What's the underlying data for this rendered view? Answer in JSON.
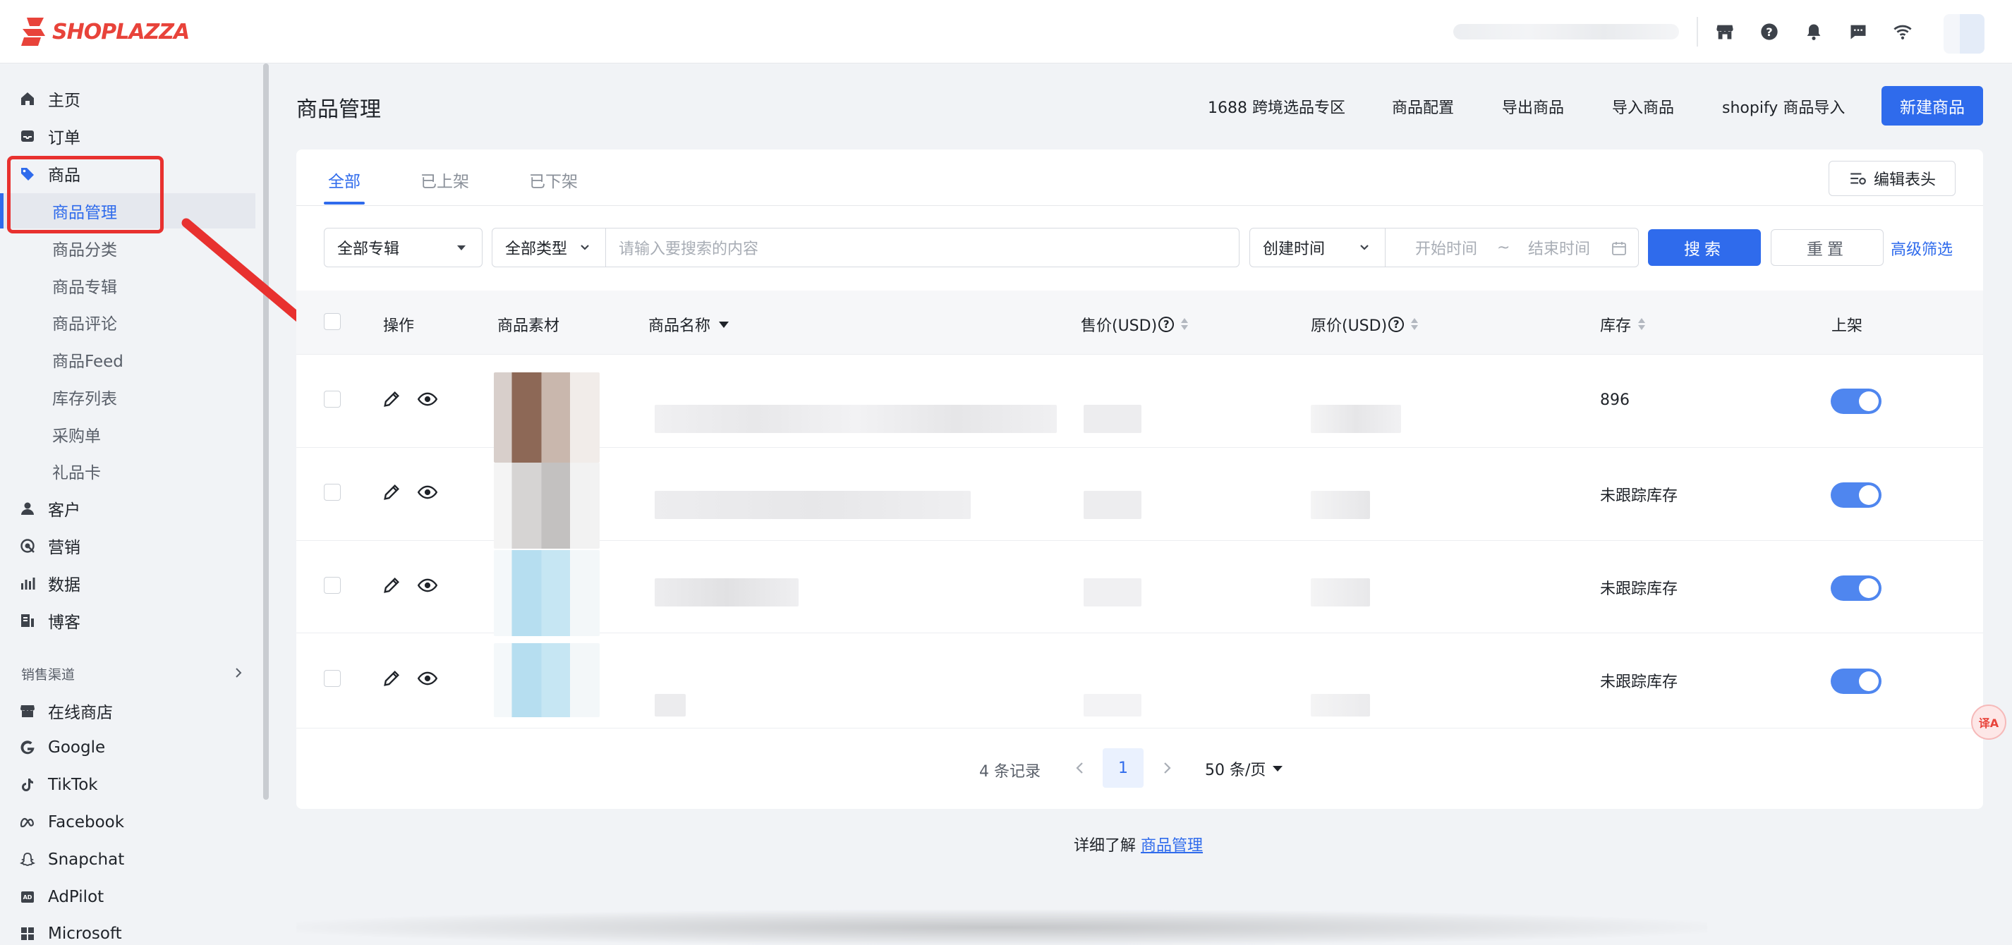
{
  "brand": {
    "name": "SHOPLAZZA",
    "color": "#e8433a"
  },
  "accent": "#2f6bec",
  "topbar": {
    "icons": [
      "store-icon",
      "help-icon",
      "bell-icon",
      "message-icon",
      "wifi-icon"
    ]
  },
  "sidebar": {
    "items": [
      {
        "label": "主页",
        "icon": "home-icon"
      },
      {
        "label": "订单",
        "icon": "inbox-icon"
      },
      {
        "label": "商品",
        "icon": "tag-icon"
      },
      {
        "label": "客户",
        "icon": "user-icon"
      },
      {
        "label": "营销",
        "icon": "target-icon"
      },
      {
        "label": "数据",
        "icon": "bar-chart-icon"
      },
      {
        "label": "博客",
        "icon": "blog-icon"
      }
    ],
    "sub_items": [
      "商品管理",
      "商品分类",
      "商品专辑",
      "商品评论",
      "商品Feed",
      "库存列表",
      "采购单",
      "礼品卡"
    ],
    "active_sub": "商品管理",
    "section_title": "销售渠道",
    "channels": [
      {
        "label": "在线商店",
        "icon": "store-icon"
      },
      {
        "label": "Google",
        "icon": "google-icon"
      },
      {
        "label": "TikTok",
        "icon": "tiktok-icon"
      },
      {
        "label": "Facebook",
        "icon": "meta-icon"
      },
      {
        "label": "Snapchat",
        "icon": "snapchat-icon"
      },
      {
        "label": "AdPilot",
        "icon": "adpilot-icon"
      },
      {
        "label": "Microsoft",
        "icon": "microsoft-icon"
      }
    ]
  },
  "page": {
    "title": "商品管理",
    "actions": [
      "1688 跨境选品专区",
      "商品配置",
      "导出商品",
      "导入商品",
      "shopify 商品导入"
    ],
    "primary_action": "新建商品"
  },
  "tabs": [
    "全部",
    "已上架",
    "已下架"
  ],
  "active_tab": "全部",
  "edit_header_label": "编辑表头",
  "filters": {
    "collection": "全部专辑",
    "type": "全部类型",
    "search_placeholder": "请输入要搜索的内容",
    "date_field": "创建时间",
    "start_placeholder": "开始时间",
    "range_sep": "~",
    "end_placeholder": "结束时间",
    "search_label": "搜索",
    "reset_label": "重置",
    "advanced_label": "高级筛选"
  },
  "table": {
    "columns": [
      "操作",
      "商品素材",
      "商品名称",
      "售价(USD)",
      "原价(USD)",
      "库存",
      "上架"
    ],
    "rows": [
      {
        "stock": "896",
        "published": true
      },
      {
        "stock": "未跟踪库存",
        "published": true
      },
      {
        "stock": "未跟踪库存",
        "published": true
      },
      {
        "stock": "未跟踪库存",
        "published": true
      }
    ]
  },
  "pagination": {
    "total": "4 条记录",
    "current_page": "1",
    "page_size": "50 条/页"
  },
  "footer": {
    "prefix": "详细了解",
    "link": "商品管理"
  }
}
